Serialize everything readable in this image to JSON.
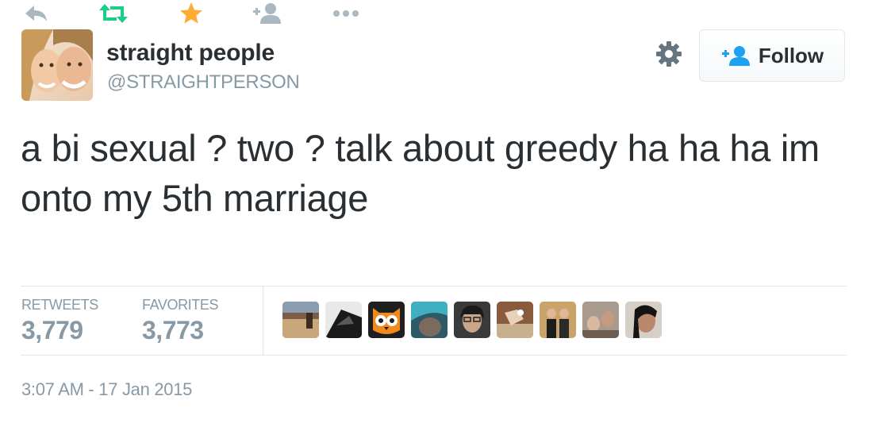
{
  "user": {
    "name": "straight people",
    "handle": "@STRAIGHTPERSON",
    "follow_label": "Follow"
  },
  "tweet": {
    "text": "a bi sexual ? two ? talk about greedy ha ha ha im onto my 5th marriage",
    "timestamp": "3:07 AM - 17 Jan 2015"
  },
  "stats": {
    "retweets_label": "RETWEETS",
    "retweets": "3,779",
    "favorites_label": "FAVORITES",
    "favorites": "3,773"
  },
  "actions": [
    "reply-icon",
    "retweet-icon",
    "favorite-icon",
    "follow-user-icon",
    "more-icon"
  ],
  "colors": {
    "retweet_green": "#19cf86",
    "favorite_gold": "#ffac33",
    "muted": "#8899a6",
    "text": "#292f33",
    "border": "#e1e8ed"
  }
}
